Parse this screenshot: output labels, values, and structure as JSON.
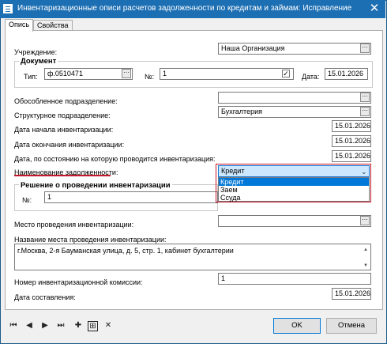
{
  "window": {
    "title": "Инвентаризационные описи расчетов задолженности по кредитам и займам: Исправление",
    "close_glyph": "✕"
  },
  "tabs": [
    {
      "label": "Опись",
      "active": true
    },
    {
      "label": "Свойства",
      "active": false
    }
  ],
  "form": {
    "institution_label": "Учреждение:",
    "institution_value": "Наша Организация",
    "document_group": "Документ",
    "type_label": "Тип:",
    "type_value": "ф.0510471",
    "number_label": "№:",
    "number_value": "1",
    "date_label": "Дата:",
    "date_value": "15.01.2026",
    "separate_unit_label": "Обособленное подразделение:",
    "separate_unit_value": "",
    "structural_unit_label": "Структурное подразделение:",
    "structural_unit_value": "Бухгалтерия",
    "start_date_label": "Дата начала инвентаризации:",
    "start_date_value": "15.01.2026",
    "end_date_label": "Дата окончания инвентаризации:",
    "end_date_value": "15.01.2026",
    "as_of_date_label": "Дата, по состоянию на которую проводится инвентаризация:",
    "as_of_date_value": "15.01.2026",
    "debt_name_label": "Наименование задолженности:",
    "debt_name_selected": "Кредит",
    "debt_name_options": [
      "Кредит",
      "Заем",
      "Ссуда"
    ],
    "decision_group": "Решение о проведении инвентаризации",
    "decision_number_label": "№:",
    "decision_number_value": "1",
    "place_label": "Место проведения инвентаризации:",
    "place_value": "",
    "place_name_label": "Название места проведения инвентаризации:",
    "place_name_value": "г.Москва, 2-я Бауманская улица, д. 5, стр. 1, кабинет бухгалтерии",
    "commission_number_label": "Номер инвентаризационной комиссии:",
    "commission_number_value": "1",
    "compiled_date_label": "Дата составления:",
    "compiled_date_value": "15.01.2026",
    "check_glyph": "✓",
    "dots_glyph": "···"
  },
  "toolbar": {
    "first_icon": "⏮",
    "prev_icon": "◀",
    "next_icon": "▶",
    "last_icon": "⏭",
    "add_icon": "✚",
    "add_copy_icon": "⊞",
    "delete_icon": "✕"
  },
  "buttons": {
    "ok_label": "OK",
    "cancel_label": "Отмена"
  },
  "colors": {
    "titlebar": "#1d6fb3",
    "highlight_border": "#c21a2a",
    "selected_option": "#0078d7"
  }
}
